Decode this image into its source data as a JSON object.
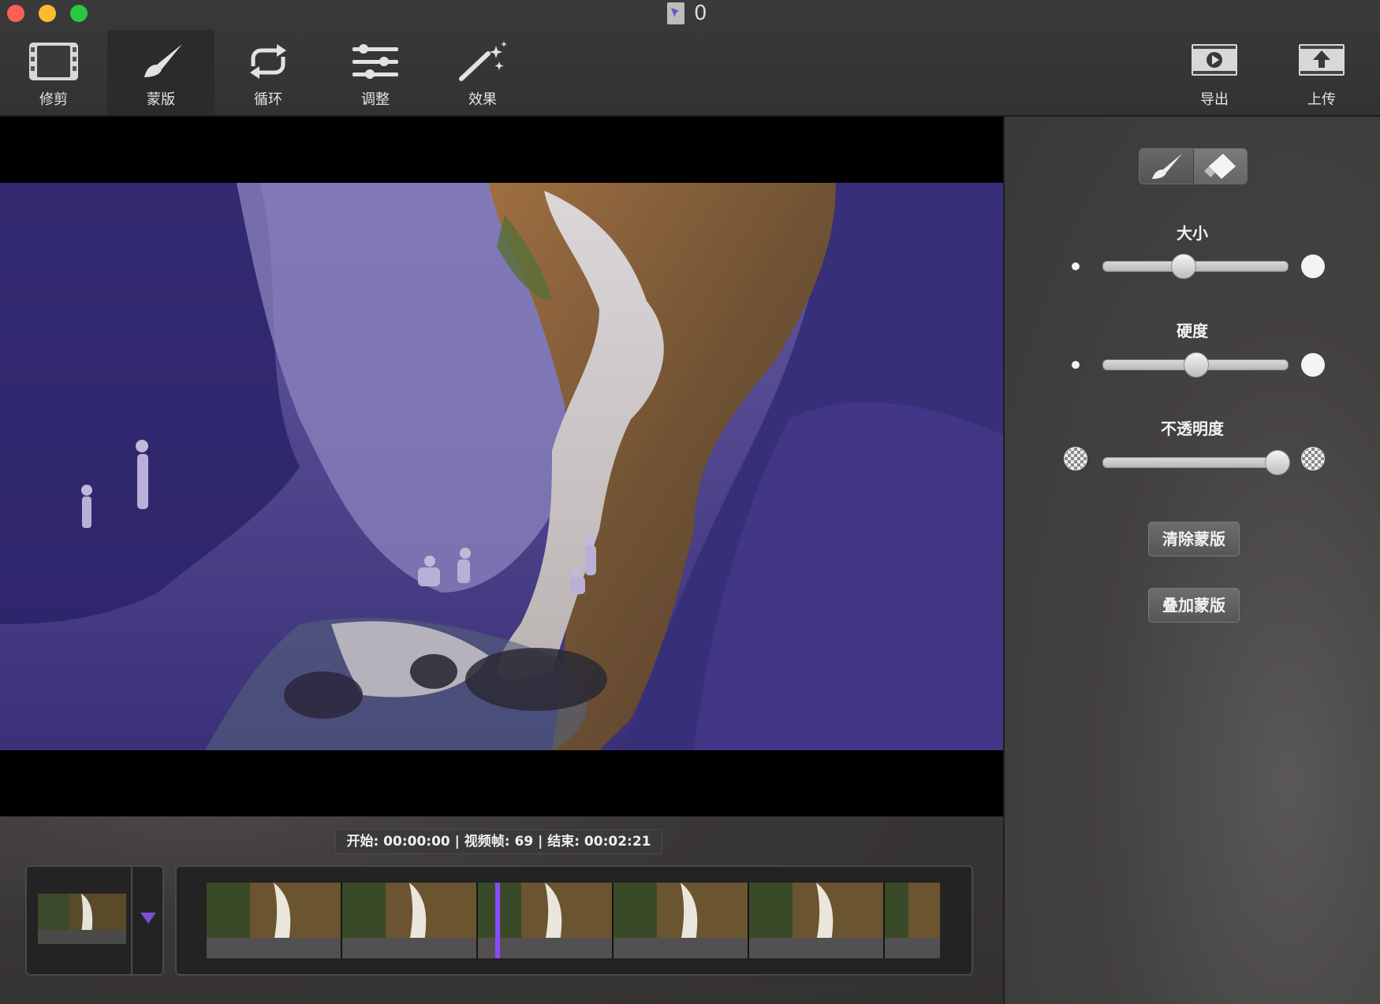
{
  "window": {
    "title": "0"
  },
  "toolbar": {
    "tools": [
      {
        "label": "修剪",
        "icon": "film-trim-icon"
      },
      {
        "label": "蒙版",
        "icon": "brush-icon"
      },
      {
        "label": "循环",
        "icon": "loop-icon"
      },
      {
        "label": "调整",
        "icon": "sliders-icon"
      },
      {
        "label": "效果",
        "icon": "magic-wand-icon"
      }
    ],
    "active_tool": "蒙版",
    "actions": [
      {
        "label": "导出",
        "icon": "export-film-icon"
      },
      {
        "label": "上传",
        "icon": "upload-film-icon"
      }
    ]
  },
  "timeline": {
    "info": "开始: 00:00:00 | 视频帧: 69 | 结束: 00:02:21"
  },
  "panel": {
    "modes": [
      "brush",
      "eraser"
    ],
    "active_mode": "eraser",
    "size": {
      "label": "大小",
      "value": 0.43
    },
    "hardness": {
      "label": "硬度",
      "value": 0.5
    },
    "opacity": {
      "label": "不透明度",
      "value": 0.94
    },
    "clear_button": "清除蒙版",
    "add_button": "叠加蒙版"
  },
  "colors": {
    "mask_overlay": "#3a2f8a",
    "playhead": "#8a4bff",
    "accent_arrow": "#7b4fd0"
  }
}
